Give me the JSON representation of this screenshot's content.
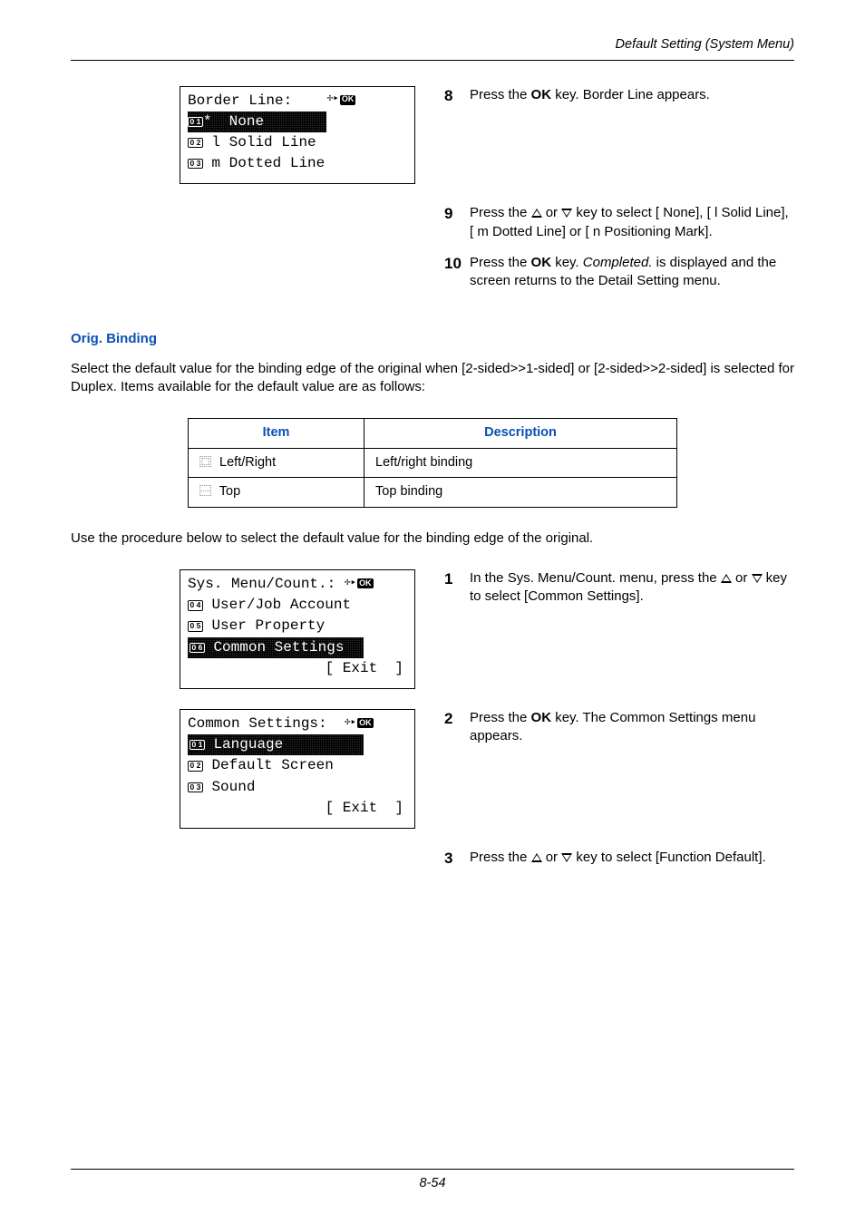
{
  "running_head": "Default Setting (System Menu)",
  "page_num": "8-54",
  "lcd1": {
    "title": "Border Line:",
    "num1": "0 1",
    "opt1_prefix": "* ",
    "opt1": "None",
    "num2": "0 2",
    "opt2_prefix": "l ",
    "opt2": "Solid Line",
    "num3": "0 3",
    "opt3_prefix": "m ",
    "opt3": "Dotted Line"
  },
  "s8": {
    "n": "8",
    "a": "Press the ",
    "b": " key. Border Line appears."
  },
  "s9": {
    "n": "9",
    "a": "Press the ",
    "b": " or ",
    "c": " key to select [  None], [ l Solid Line], [ m Dotted Line] or [ n Positioning Mark]."
  },
  "s10": {
    "n": "10",
    "a": "Press the ",
    "b": " key. ",
    "c": "Completed.",
    "d": " is displayed and the screen returns to the Detail Setting menu."
  },
  "orig_binding": {
    "head": "Orig. Binding",
    "body": "Select the default value for the binding edge of the original when [2-sided>>1-sided] or [2-sided>>2-sided] is selected for Duplex. Items available for the default value are as follows:",
    "th_item": "Item",
    "th_desc": "Description",
    "r1_item": "Left/Right",
    "r1_desc": "Left/right binding",
    "r2_item": "Top",
    "r2_desc": "Top binding",
    "after": "Use the procedure below to select the default value for the binding edge of the original."
  },
  "lcd2": {
    "title": "Sys. Menu/Count.:",
    "num1": "0 4",
    "opt1": "User/Job Account",
    "num2": "0 5",
    "opt2": "User Property",
    "num3": "0 6",
    "opt3": "Common Settings",
    "exit": "[ Exit  ]"
  },
  "lcd3": {
    "title": "Common Settings:",
    "num1": "0 1",
    "opt1": "Language",
    "num2": "0 2",
    "opt2": "Default Screen",
    "num3": "0 3",
    "opt3": "Sound",
    "exit": "[ Exit  ]"
  },
  "s1": {
    "n": "1",
    "a": "In the Sys. Menu/Count. menu, press the ",
    "b": " or ",
    "c": " key to select [Common Settings]."
  },
  "s2": {
    "n": "2",
    "a": "Press the ",
    "b": " key. The Common Settings menu appears."
  },
  "s3": {
    "n": "3",
    "a": "Press the ",
    "b": " or ",
    "c": " key to select [Function Default]."
  },
  "ok": "OK"
}
